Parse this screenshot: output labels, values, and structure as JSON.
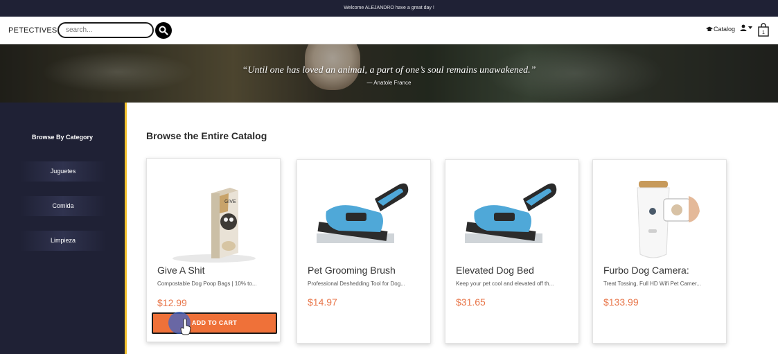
{
  "topbar": {
    "welcome_text": "Welcome ALEJANDRO have a great day !"
  },
  "header": {
    "brand": "PETECTIVES",
    "search_placeholder": "search...",
    "catalog_label": "Catalog"
  },
  "hero": {
    "quote": "“Until one has loved an animal, a part of one’s soul remains unawakened.”",
    "author": "— Anatole France"
  },
  "sidebar": {
    "title": "Browse By Category",
    "categories": [
      {
        "label": "Juguetes"
      },
      {
        "label": "Comida"
      },
      {
        "label": "Limpieza"
      }
    ]
  },
  "main": {
    "title": "Browse the Entire Catalog",
    "products": [
      {
        "name": "Give A Shit",
        "description": "Compostable Dog Poop Bags | 10% to...",
        "price": "$12.99",
        "image": "dog-poop-bags-box"
      },
      {
        "name": "Pet Grooming Brush",
        "description": "Professional Deshedding Tool for Dog...",
        "price": "$14.97",
        "image": "deshedding-brush"
      },
      {
        "name": "Elevated Dog Bed",
        "description": "Keep your pet cool and elevated off th...",
        "price": "$31.65",
        "image": "deshedding-brush"
      },
      {
        "name": "Furbo Dog Camera:",
        "description": "Treat Tossing, Full HD Wifi Pet Camer...",
        "price": "$133.99",
        "image": "pet-camera"
      }
    ],
    "add_to_cart_label": "ADD TO CART"
  },
  "colors": {
    "navy": "#1f2135",
    "accent_orange": "#ef7139",
    "price_orange": "#e8764a",
    "sidebar_border_yellow": "#f2c12e"
  }
}
